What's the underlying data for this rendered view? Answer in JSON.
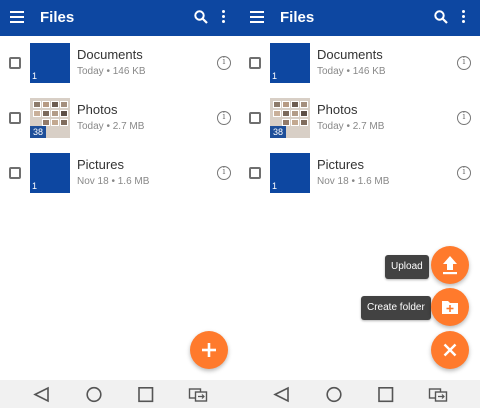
{
  "left_panel": {
    "appbar": {
      "title": "Files",
      "menu_icon": "hamburger-menu-icon",
      "search_icon": "search-icon",
      "more_icon": "more-vert-icon"
    },
    "files": [
      {
        "name": "Documents",
        "meta": "Today • 146 KB",
        "count": "1",
        "thumb": "folder"
      },
      {
        "name": "Photos",
        "meta": "Today • 2.7 MB",
        "count": "38",
        "thumb": "photo"
      },
      {
        "name": "Pictures",
        "meta": "Nov 18 • 1.6 MB",
        "count": "1",
        "thumb": "folder"
      }
    ],
    "fab": {
      "icon": "plus-icon"
    }
  },
  "right_panel": {
    "appbar": {
      "title": "Files",
      "menu_icon": "hamburger-menu-icon",
      "search_icon": "search-icon",
      "more_icon": "more-vert-icon"
    },
    "files": [
      {
        "name": "Documents",
        "meta": "Today • 146 KB",
        "count": "1",
        "thumb": "folder"
      },
      {
        "name": "Photos",
        "meta": "Today • 2.7 MB",
        "count": "38",
        "thumb": "photo"
      },
      {
        "name": "Pictures",
        "meta": "Nov 18 • 1.6 MB",
        "count": "1",
        "thumb": "folder"
      }
    ],
    "fab_menu": {
      "upload_label": "Upload",
      "create_folder_label": "Create folder",
      "upload_icon": "upload-icon",
      "create_folder_icon": "create-folder-icon",
      "close_icon": "close-icon"
    }
  },
  "navbar": {
    "back_icon": "back-triangle-icon",
    "home_icon": "home-circle-icon",
    "recents_icon": "recents-square-icon",
    "switch_icon": "switch-sim-icon"
  },
  "colors": {
    "appbar": "#0d47a1",
    "fab": "#ff7a2c",
    "thumb": "#0d47a1",
    "label_bg": "#424242"
  }
}
